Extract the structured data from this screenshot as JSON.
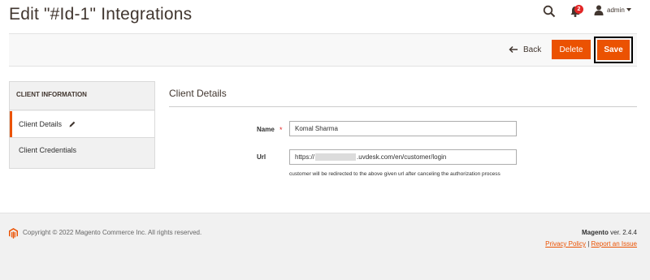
{
  "header": {
    "title": "Edit \"#Id-1\" Integrations",
    "notification_count": "2",
    "user": "admin"
  },
  "toolbar": {
    "back_label": "Back",
    "delete_label": "Delete",
    "save_label": "Save"
  },
  "sidebar": {
    "title": "CLIENT INFORMATION",
    "items": [
      {
        "label": "Client Details",
        "active": true
      },
      {
        "label": "Client Credentials",
        "active": false
      }
    ]
  },
  "main": {
    "section_title": "Client Details",
    "fields": {
      "name": {
        "label": "Name",
        "required": "*",
        "value": "Komal Sharma"
      },
      "url": {
        "label": "Url",
        "value_prefix": "https://",
        "value_suffix": ".uvdesk.com/en/customer/login",
        "note": "customer will be redirected to the above given url after canceling the authorization process"
      }
    }
  },
  "footer": {
    "copyright": "Copyright © 2022 Magento Commerce Inc. All rights reserved.",
    "brand": "Magento",
    "version": "ver. 2.4.4",
    "privacy_label": "Privacy Policy",
    "separator": "|",
    "report_label": "Report an Issue"
  },
  "colors": {
    "accent": "#eb5202",
    "badge": "#e22626",
    "footer_bg": "#f1f1f1"
  },
  "icons": [
    "search-icon",
    "bell-icon",
    "user-icon",
    "back-arrow-icon",
    "pencil-icon",
    "magento-logo-icon"
  ]
}
